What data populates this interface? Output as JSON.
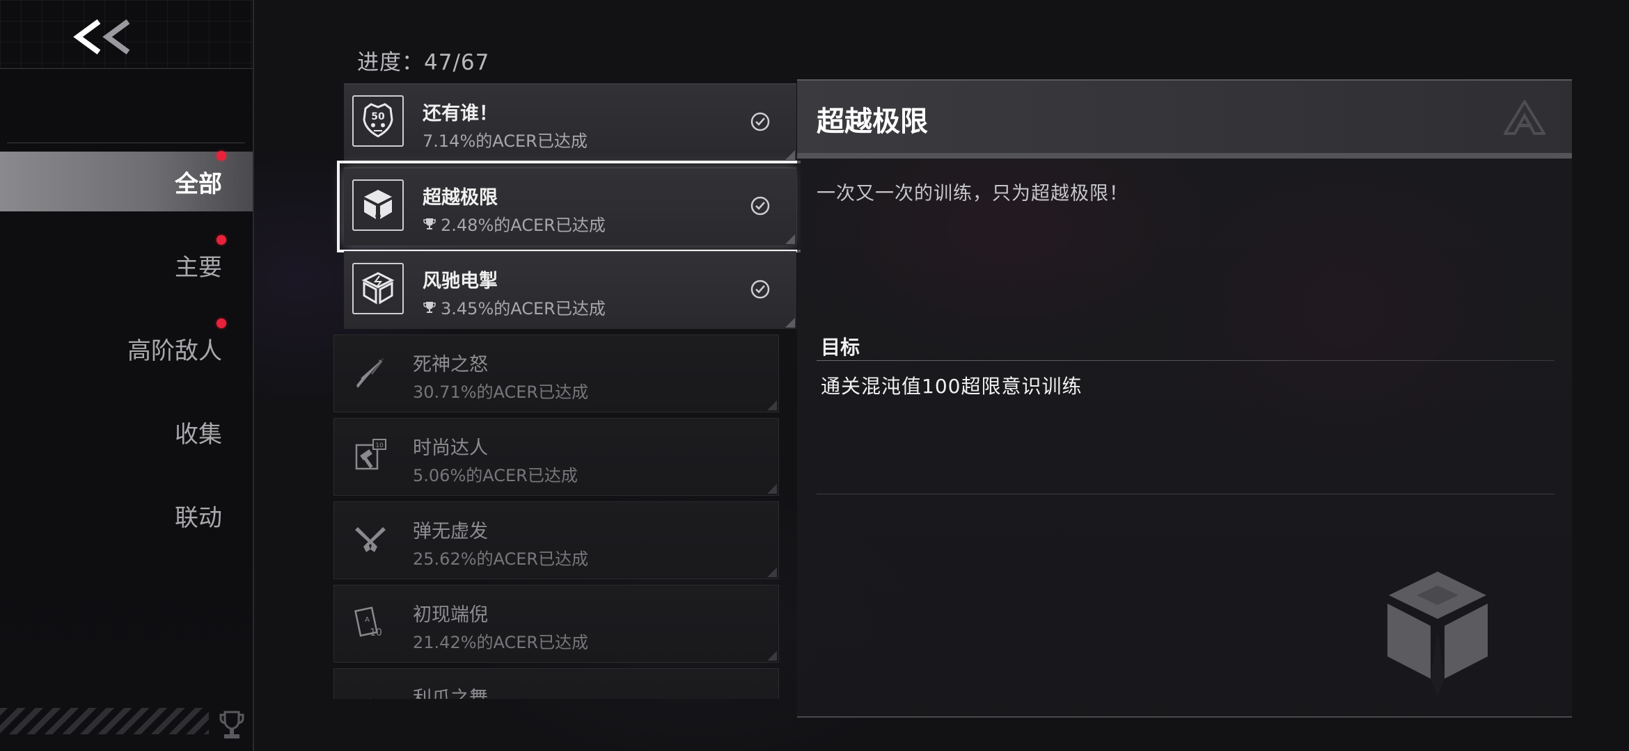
{
  "sidebar": {
    "back_label": "<<",
    "items": [
      {
        "label": "全部",
        "active": true,
        "dot": true
      },
      {
        "label": "主要",
        "active": false,
        "dot": true
      },
      {
        "label": "高阶敌人",
        "active": false,
        "dot": true
      },
      {
        "label": "收集",
        "active": false,
        "dot": false
      },
      {
        "label": "联动",
        "active": false,
        "dot": false
      }
    ]
  },
  "progress": "进度：47/67",
  "achievements": [
    {
      "title": "还有谁！",
      "sub": "7.14%的ACER已达成",
      "completed": true,
      "trophy": false,
      "icon": "skull-50-icon"
    },
    {
      "title": "超越极限",
      "sub": "2.48%的ACER已达成",
      "completed": true,
      "trophy": true,
      "selected": true,
      "icon": "cube-emblem-icon"
    },
    {
      "title": "风驰电掣",
      "sub": "3.45%的ACER已达成",
      "completed": true,
      "trophy": true,
      "icon": "cube-lightning-icon"
    },
    {
      "title": "死神之怒",
      "sub": "30.71%的ACER已达成",
      "completed": false,
      "icon": "blade-icon"
    },
    {
      "title": "时尚达人",
      "sub": "5.06%的ACER已达成",
      "completed": false,
      "icon": "hammer-10-icon"
    },
    {
      "title": "弹无虚发",
      "sub": "25.62%的ACER已达成",
      "completed": false,
      "icon": "crossed-pistols-icon"
    },
    {
      "title": "初现端倪",
      "sub": "21.42%的ACER已达成",
      "completed": false,
      "icon": "card-10-icon"
    },
    {
      "title": "利爪之舞",
      "sub": "",
      "completed": false,
      "icon": "claw-icon"
    }
  ],
  "detail": {
    "title": "超越极限",
    "description": "一次又一次的训练，只为超越极限！",
    "target_label": "目标",
    "target_text": "通关混沌值100超限意识训练"
  },
  "colors": {
    "accent_dot": "#e8223a",
    "selected_outline": "#f2f2f2"
  }
}
